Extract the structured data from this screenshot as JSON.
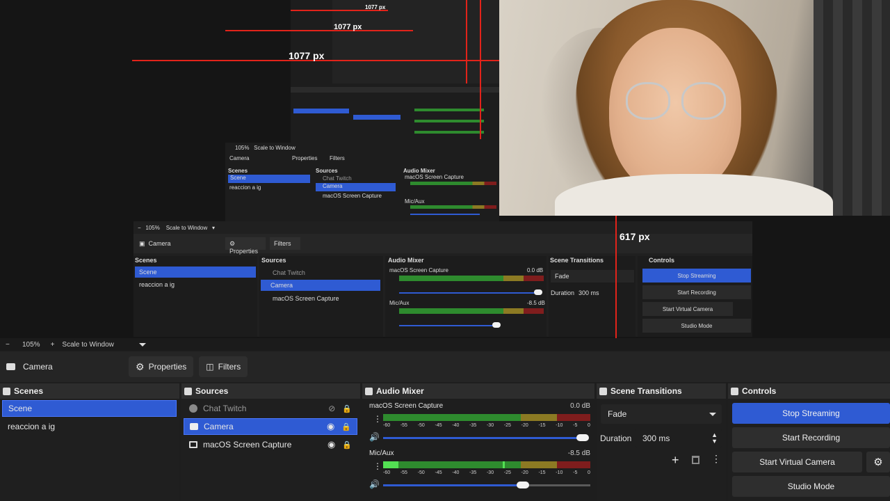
{
  "measures": {
    "big": "1077 px",
    "mid": "1077 px",
    "small": "1077 px",
    "vertical": "617 px"
  },
  "mid_obs": {
    "zoom": "105%",
    "scale_mode": "Scale to Window",
    "source_name": "Camera",
    "properties": "Properties",
    "filters": "Filters",
    "scenes_title": "Scenes",
    "scenes": [
      "Scene",
      "reaccion a ig"
    ],
    "sources_title": "Sources",
    "sources": [
      "Chat Twitch",
      "Camera",
      "macOS Screen Capture"
    ],
    "mixer_title": "Audio Mixer",
    "channels": [
      {
        "name": "macOS Screen Capture",
        "db": "0.0 dB"
      },
      {
        "name": "Mic/Aux",
        "db": "-8.5 dB"
      }
    ],
    "transitions_title": "Scene Transitions",
    "transition": "Fade",
    "duration_label": "Duration",
    "duration_value": "300 ms",
    "controls_title": "Controls",
    "controls": [
      "Stop Streaming",
      "Start Recording",
      "Start Virtual Camera",
      "Studio Mode"
    ]
  },
  "small_obs": {
    "zoom": "105%",
    "scale_mode": "Scale to Window",
    "source_name": "Camera",
    "properties": "Properties",
    "filters": "Filters",
    "scenes_title": "Scenes",
    "scenes": [
      "Scene",
      "reaccion a ig"
    ],
    "sources_title": "Sources",
    "sources": [
      "Chat Twitch",
      "Camera",
      "macOS Screen Capture"
    ],
    "mixer_title": "Audio Mixer",
    "channels": [
      "macOS Screen Capture",
      "Mic/Aux"
    ]
  },
  "obs": {
    "zoom_minus": "−",
    "zoom": "105%",
    "zoom_plus": "+",
    "scale_mode": "Scale to Window",
    "source_name": "Camera",
    "properties": "Properties",
    "filters": "Filters",
    "scenes": {
      "title": "Scenes",
      "items": [
        "Scene",
        "reaccion a ig"
      ],
      "selected": 0
    },
    "sources": {
      "title": "Sources",
      "items": [
        "Chat Twitch",
        "Camera",
        "macOS Screen Capture"
      ],
      "selected": 1
    },
    "mixer": {
      "title": "Audio Mixer",
      "ticks": [
        "-60",
        "-55",
        "-50",
        "-45",
        "-40",
        "-35",
        "-30",
        "-25",
        "-20",
        "-15",
        "-10",
        "-5",
        "0"
      ],
      "channels": [
        {
          "name": "macOS Screen Capture",
          "db": "0.0 dB",
          "level": 0.0,
          "volume": 1.0
        },
        {
          "name": "Mic/Aux",
          "db": "-8.5 dB",
          "level": 0.05,
          "volume": 0.65
        }
      ]
    },
    "transitions": {
      "title": "Scene Transitions",
      "transition": "Fade",
      "duration_label": "Duration",
      "duration_value": "300 ms"
    },
    "controls": {
      "title": "Controls",
      "stop_streaming": "Stop Streaming",
      "start_recording": "Start Recording",
      "start_virtual_camera": "Start Virtual Camera",
      "studio_mode": "Studio Mode"
    }
  },
  "icons": {
    "camera": "camera-icon",
    "gear": "gear-icon",
    "eye": "eye-icon",
    "lock": "lock-icon"
  },
  "colors": {
    "accent": "#2f5bd3",
    "measure": "#e2231a",
    "meter_green": "#2e8b2e",
    "meter_yellow": "#8c7a23",
    "meter_red": "#7f1d1d"
  }
}
